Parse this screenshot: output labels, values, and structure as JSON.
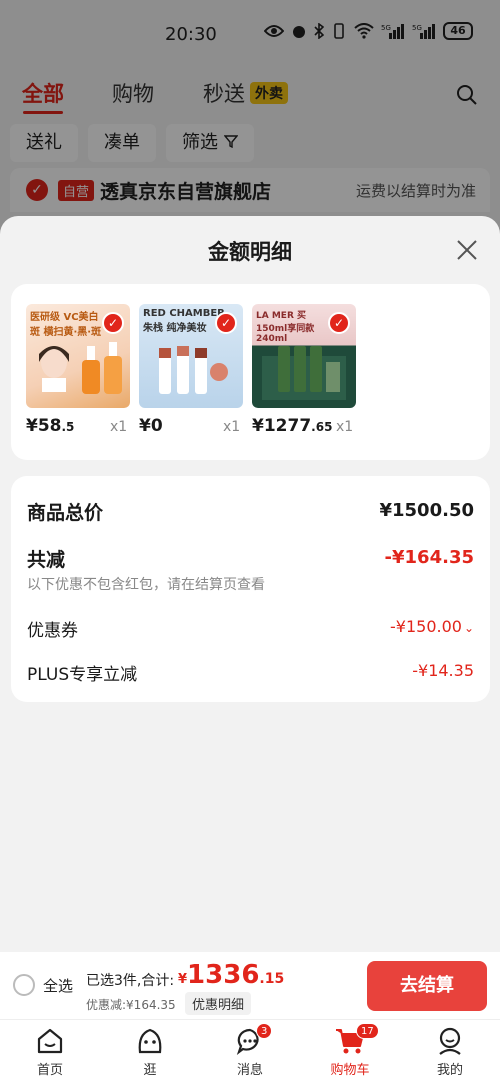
{
  "status_bar": {
    "time": "20:30",
    "battery": "46"
  },
  "tabs": [
    {
      "label": "全部"
    },
    {
      "label": "购物"
    },
    {
      "label": "秒送"
    }
  ],
  "tab_badge": "外卖",
  "filters": [
    "送礼",
    "凑单",
    "筛选"
  ],
  "store": {
    "tag": "自营",
    "name": "透真京东自营旗舰店",
    "freight_note": "运费以结算时为准"
  },
  "sheet": {
    "title": "金额明细",
    "products": [
      {
        "image_text": "医研级 VC美白斑 横扫黄·黑·斑",
        "price": "¥58",
        "price_dec": ".5",
        "qty": "x1"
      },
      {
        "image_text": "RED CHAMBER 朱栈 纯净美妆",
        "price": "¥0",
        "price_dec": "",
        "qty": "x1"
      },
      {
        "image_text": "LA MER 买150ml享同款240ml",
        "price": "¥1277",
        "price_dec": ".65",
        "qty": "x1"
      }
    ],
    "summary": {
      "total_label": "商品总价",
      "total_value": "¥1500.50",
      "reduce_label": "共减",
      "reduce_value": "-¥164.35",
      "note": "以下优惠不包含红包，请在结算页查看",
      "coupon_label": "优惠券",
      "coupon_value": "-¥150.00",
      "plus_label": "PLUS专享立减",
      "plus_value": "-¥14.35"
    }
  },
  "checkout": {
    "select_all": "全选",
    "selected_text": "已选3件,合计:",
    "currency": "¥",
    "amount_int": "1336",
    "amount_dec": ".15",
    "discount_text": "优惠减:¥164.35",
    "detail_label": "优惠明细",
    "pay_label": "去结算"
  },
  "nav": [
    {
      "label": "首页"
    },
    {
      "label": "逛"
    },
    {
      "label": "消息",
      "badge": "3"
    },
    {
      "label": "购物车",
      "badge": "17"
    },
    {
      "label": "我的"
    }
  ],
  "colors": {
    "accent": "#e1251b",
    "pay_button": "#e8423c",
    "sheet_bg": "#f2f2f2"
  }
}
